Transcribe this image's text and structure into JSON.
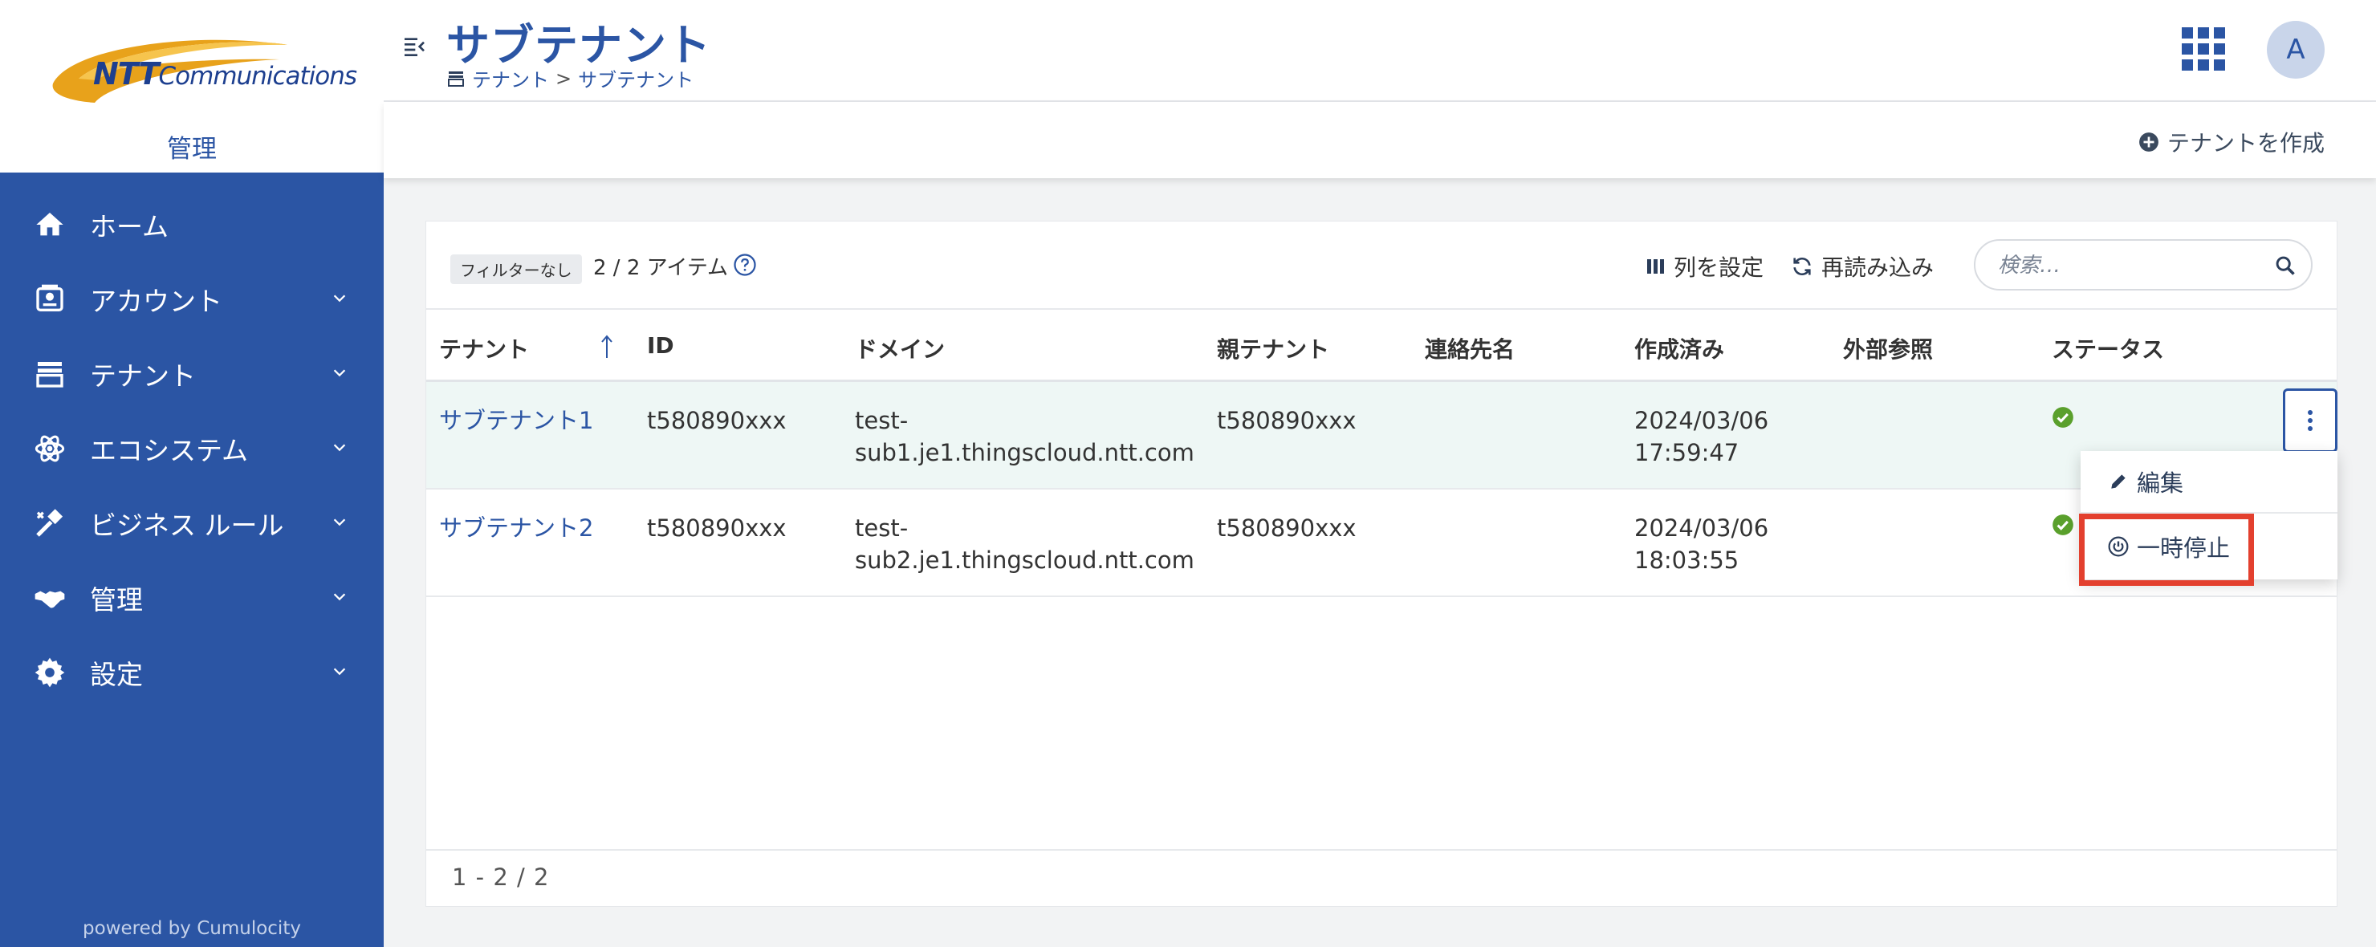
{
  "brand": {
    "logo_text_bold": "NTT",
    "logo_text_rest": "Communications",
    "app_name": "管理"
  },
  "sidebar": {
    "items": [
      {
        "label": "ホーム",
        "icon": "home-icon"
      },
      {
        "label": "アカウント",
        "icon": "account-icon"
      },
      {
        "label": "テナント",
        "icon": "tenant-icon"
      },
      {
        "label": "エコシステム",
        "icon": "ecosystem-icon"
      },
      {
        "label": "ビジネス ルール",
        "icon": "business-rule-icon"
      },
      {
        "label": "管理",
        "icon": "handshake-icon"
      },
      {
        "label": "設定",
        "icon": "gear-icon"
      }
    ],
    "powered_by": "powered by Cumulocity"
  },
  "header": {
    "title": "サブテナント",
    "breadcrumb": [
      "テナント",
      "サブテナント"
    ],
    "avatar_initial": "A"
  },
  "actions": {
    "create_tenant": "テナントを作成"
  },
  "toolbar": {
    "filter_badge": "フィルターなし",
    "item_count": "2 / 2 アイテム",
    "configure_columns": "列を設定",
    "reload": "再読み込み",
    "search_placeholder": "検索…"
  },
  "table": {
    "columns": [
      "テナント",
      "ID",
      "ドメイン",
      "親テナント",
      "連絡先名",
      "作成済み",
      "外部参照",
      "ステータス"
    ],
    "rows": [
      {
        "tenant": "サブテナント1",
        "id": "t580890xxx",
        "domain_l1": "test-",
        "domain_l2": "sub1.je1.thingscloud.ntt.com",
        "parent": "t580890xxx",
        "contact": "",
        "created_l1": "2024/03/06",
        "created_l2": "17:59:47",
        "external": "",
        "status": "active"
      },
      {
        "tenant": "サブテナント2",
        "id": "t580890xxx",
        "domain_l1": "test-",
        "domain_l2": "sub2.je1.thingscloud.ntt.com",
        "parent": "t580890xxx",
        "contact": "",
        "created_l1": "2024/03/06",
        "created_l2": "18:03:55",
        "external": "",
        "status": "active"
      }
    ]
  },
  "row_menu": {
    "edit": "編集",
    "suspend": "一時停止"
  },
  "footer": {
    "pagination": "1 - 2 / 2"
  },
  "colors": {
    "sidebar_bg": "#2b55a4",
    "accent": "#2b55a4",
    "success": "#5aa02c",
    "highlight": "#e3402e"
  }
}
